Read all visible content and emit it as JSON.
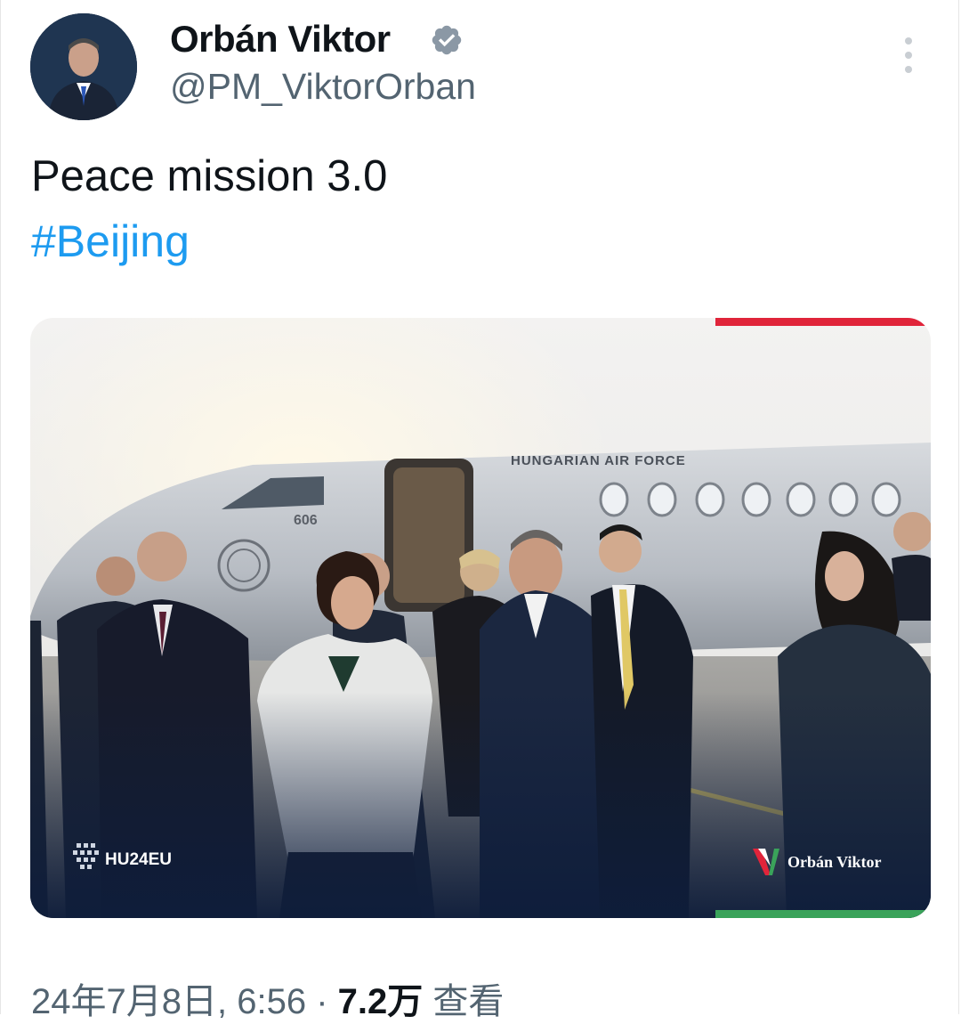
{
  "tweet": {
    "author_name": "Orbán Viktor",
    "author_handle": "@PM_ViktorOrban",
    "verified": true,
    "text_line1": "Peace mission 3.0",
    "hashtag": "#Beijing",
    "date": "24年7月8日, 6:56",
    "separator": "·",
    "views_count": "7.2万",
    "views_label": "查看"
  },
  "media": {
    "aircraft_text": "HUNGARIAN AIR FORCE",
    "aircraft_number": "606",
    "watermark_left": "HU24EU",
    "watermark_right": "Orbán Viktor"
  },
  "colors": {
    "accent": "#1d9bf0",
    "text_primary": "#0f1419",
    "text_secondary": "#536471",
    "flag_red": "#e0243a",
    "flag_green": "#3aa35a"
  },
  "icons": [
    "verified-badge-icon",
    "more-options-icon"
  ]
}
